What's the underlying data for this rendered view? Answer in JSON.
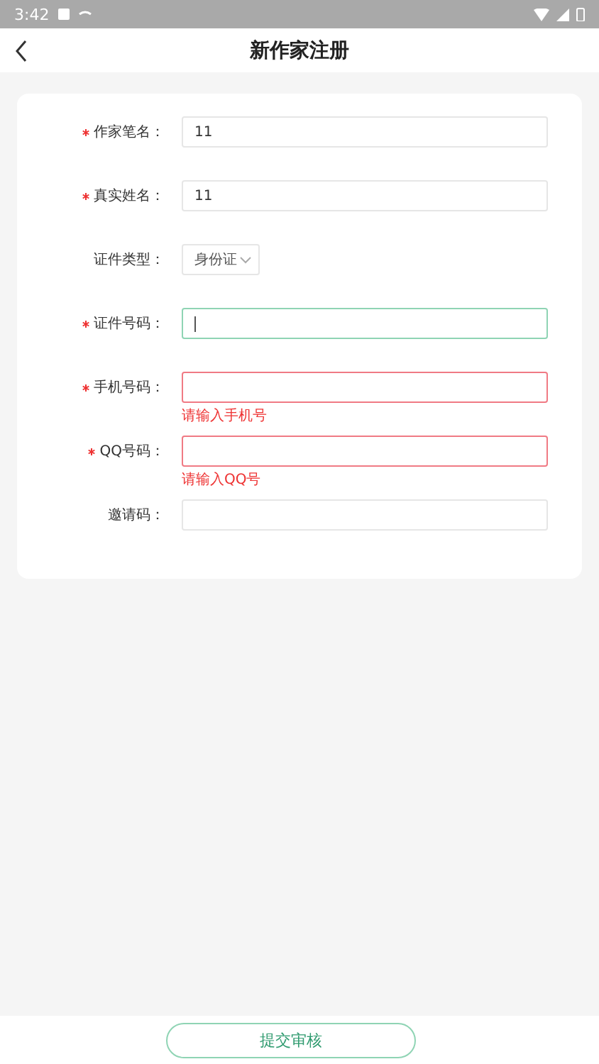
{
  "status_bar": {
    "time": "3:42"
  },
  "header": {
    "title": "新作家注册"
  },
  "fields": [
    {
      "kind": "text",
      "label": "作家笔名：",
      "required": true,
      "value": "11",
      "focused": false,
      "error": false
    },
    {
      "kind": "text",
      "label": "真实姓名：",
      "required": true,
      "value": "11",
      "focused": false,
      "error": false
    },
    {
      "kind": "select",
      "label": "证件类型：",
      "required": false,
      "value": "身份证",
      "focused": false,
      "error": false
    },
    {
      "kind": "text",
      "label": "证件号码：",
      "required": true,
      "focused": true,
      "error": false
    },
    {
      "kind": "text",
      "label": "手机号码：",
      "required": true,
      "focused": false,
      "error": true,
      "message": "请输入手机号"
    },
    {
      "kind": "text",
      "label": "QQ号码：",
      "required": true,
      "focused": false,
      "error": true,
      "message": "请输入QQ号"
    },
    {
      "kind": "text",
      "label": "邀请码：",
      "required": false,
      "focused": false,
      "error": false
    }
  ],
  "submit": {
    "label": "提交审核"
  }
}
